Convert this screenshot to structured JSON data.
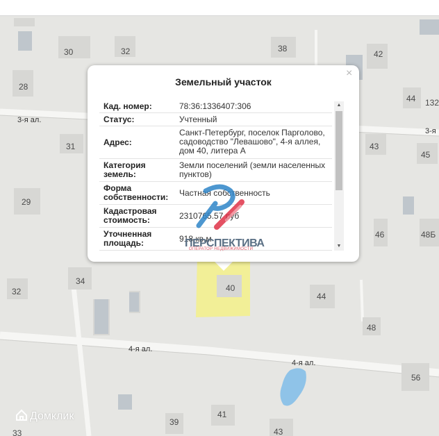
{
  "map": {
    "house_numbers": [
      "30",
      "32",
      "38",
      "42",
      "28",
      "44",
      "132",
      "31",
      "43",
      "45",
      "29",
      "46",
      "48Б",
      "34",
      "32",
      "40",
      "44",
      "48",
      "56",
      "39",
      "41",
      "43",
      "33"
    ],
    "streets": [
      "3-я ал.",
      "3-я",
      "4-я ал.",
      "4-я ал."
    ],
    "brand": "Домклик"
  },
  "popup": {
    "title": "Земельный участок",
    "close_label": "×",
    "rows": [
      {
        "key": "Кад. номер:",
        "value": "78:36:1336407:306"
      },
      {
        "key": "Статус:",
        "value": "Учтенный"
      },
      {
        "key": "Адрес:",
        "value": "Санкт-Петербург, поселок Парголово, садоводство \"Левашово\", 4-я аллея, дом 40, литера А"
      },
      {
        "key": "Категория земель:",
        "value": "Земли поселений (земли населенных пунктов)"
      },
      {
        "key": "Форма собственности:",
        "value": "Частная собственность"
      },
      {
        "key": "Кадастровая стоимость:",
        "value": "2310765.57 руб"
      },
      {
        "key": "Уточненная площадь:",
        "value": "918 кв.м"
      }
    ]
  },
  "watermark": {
    "text": "ПЕРСПЕКТИВА",
    "subtext": "ОПЕРАТОР НЕДВИЖИМОСТИ"
  }
}
